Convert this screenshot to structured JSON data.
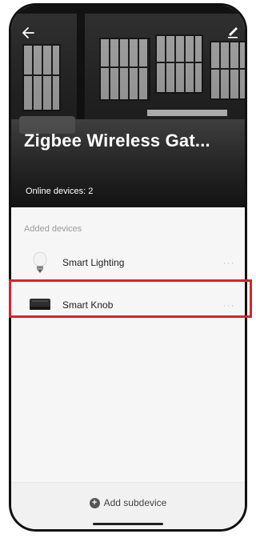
{
  "header": {
    "title": "Zigbee Wireless Gat...",
    "online_devices": "Online devices: 2",
    "back_icon": "back-arrow-icon",
    "edit_icon": "edit-pencil-icon"
  },
  "devices_section": {
    "label": "Added devices",
    "items": [
      {
        "name": "Smart Lighting",
        "icon": "light-bulb-icon",
        "more": "···"
      },
      {
        "name": "Smart Knob",
        "icon": "knob-device-icon",
        "more": "···"
      }
    ]
  },
  "footer": {
    "add_label": "Add subdevice",
    "add_icon": "plus-circle-icon"
  },
  "colors": {
    "highlight": "#d6232f"
  }
}
